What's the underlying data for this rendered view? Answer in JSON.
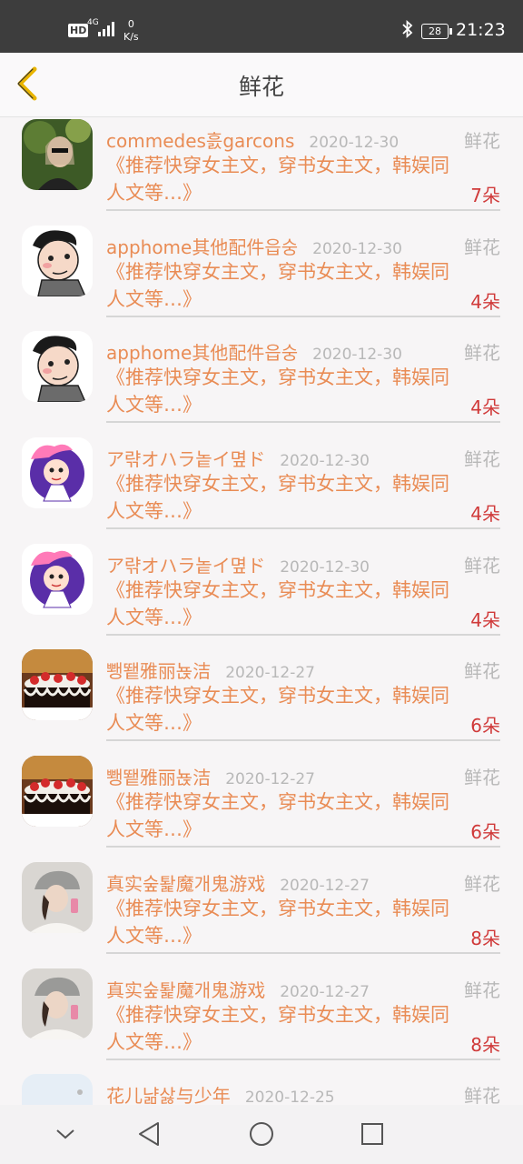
{
  "status_bar": {
    "network": "HD",
    "signal": "4G",
    "speed_value": "0",
    "speed_unit": "K/s",
    "battery": "28",
    "time": "21:23"
  },
  "header": {
    "title": "鲜花"
  },
  "items": [
    {
      "name": "commedes흜garcons",
      "date": "2020-12-30",
      "type": "鲜花",
      "desc": "《推荐快穿女主文，穿书女主文，韩娱同人文等…》",
      "count": "7朵",
      "avatar": "woman-sunglasses"
    },
    {
      "name": "apphome其他配件읍숭",
      "date": "2020-12-30",
      "type": "鲜花",
      "desc": "《推荐快穿女主文，穿书女主文，韩娱同人文等…》",
      "count": "4朵",
      "avatar": "cartoon-man"
    },
    {
      "name": "apphome其他配件읍숭",
      "date": "2020-12-30",
      "type": "鲜花",
      "desc": "《推荐快穿女主文，穿书女主文，韩娱同人文等…》",
      "count": "4朵",
      "avatar": "cartoon-man"
    },
    {
      "name": "ア랶オハラ놑イ몊ド",
      "date": "2020-12-30",
      "type": "鲜花",
      "desc": "《推荐快穿女主文，穿书女主文，韩娱同人文等…》",
      "count": "4朵",
      "avatar": "cartoon-girl"
    },
    {
      "name": "ア랶オハラ놑イ몊ド",
      "date": "2020-12-30",
      "type": "鲜花",
      "desc": "《推荐快穿女主文，穿书女主文，韩娱同人文等…》",
      "count": "4朵",
      "avatar": "cartoon-girl"
    },
    {
      "name": "뾍뙡雅丽뇭洁",
      "date": "2020-12-27",
      "type": "鲜花",
      "desc": "《推荐快穿女主文，穿书女主文，韩娱同人文等…》",
      "count": "6朵",
      "avatar": "cake"
    },
    {
      "name": "뾍뙡雅丽뇭洁",
      "date": "2020-12-27",
      "type": "鲜花",
      "desc": "《推荐快穿女主文，穿书女主文，韩娱同人文等…》",
      "count": "6朵",
      "avatar": "cake"
    },
    {
      "name": "真实숲퇉魔개鬼游戏",
      "date": "2020-12-27",
      "type": "鲜花",
      "desc": "《推荐快穿女主文，穿书女主文，韩娱同人文等…》",
      "count": "8朵",
      "avatar": "woman-hat"
    },
    {
      "name": "真实숲퇉魔개鬼游戏",
      "date": "2020-12-27",
      "type": "鲜花",
      "desc": "《推荐快穿女主文，穿书女主文，韩娱同人文等…》",
      "count": "8朵",
      "avatar": "woman-hat"
    },
    {
      "name": "花儿냚삻与少年",
      "date": "2020-12-25",
      "type": "鲜花",
      "desc": "",
      "count": "",
      "avatar": "light-photo"
    }
  ],
  "nav": {
    "back": "chevron-down-icon",
    "home": "triangle-back-icon",
    "circle": "home-circle-icon",
    "recent": "square-recent-icon"
  },
  "colors": {
    "accent_orange": "#e98c55",
    "count_red": "#d03a3a",
    "back_arrow": "#e8b400",
    "muted": "#b8b8b8"
  }
}
